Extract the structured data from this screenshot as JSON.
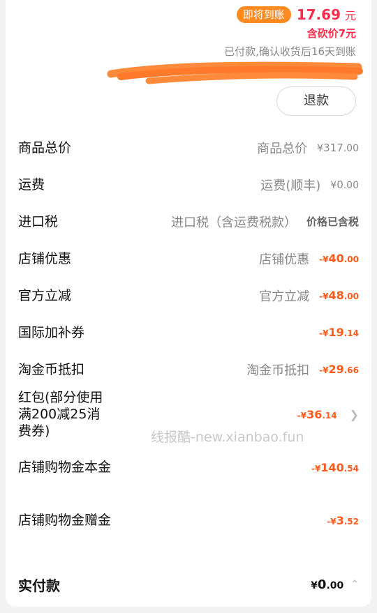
{
  "header": {
    "badge": "即将到账",
    "amount": "17.69",
    "amount_unit": "元",
    "cut_price": "含砍价7元",
    "note": "已付款,确认收货后16天到账",
    "refund_button": "退款"
  },
  "rows": [
    {
      "label": "商品总价",
      "desc": "商品总价",
      "currency": "¥",
      "amount_int": "317",
      "amount_dec": ".00",
      "style": "grey"
    },
    {
      "label": "运费",
      "desc": "运费(顺丰)",
      "currency": "¥",
      "amount_int": "0",
      "amount_dec": ".00",
      "style": "grey"
    },
    {
      "label": "进口税",
      "desc": "进口税（含运费税款）",
      "note": "价格已含税"
    },
    {
      "label": "店铺优惠",
      "desc": "店铺优惠",
      "currency": "-¥",
      "amount_int": "40",
      "amount_dec": ".00",
      "style": "red"
    },
    {
      "label": "官方立减",
      "desc": "官方立减",
      "currency": "-¥",
      "amount_int": "48",
      "amount_dec": ".00",
      "style": "red"
    },
    {
      "label": "国际加补券",
      "currency": "-¥",
      "amount_int": "19",
      "amount_dec": ".14",
      "style": "red"
    },
    {
      "label": "淘金币抵扣",
      "desc": "淘金币抵扣",
      "currency": "-¥",
      "amount_int": "29",
      "amount_dec": ".66",
      "style": "red"
    },
    {
      "label": "红包(部分使用满200减25消费券)",
      "currency": "-¥",
      "amount_int": "36",
      "amount_dec": ".14",
      "style": "red"
    },
    {
      "label": "店铺购物金本金",
      "currency": "-¥",
      "amount_int": "140",
      "amount_dec": ".54",
      "style": "red"
    },
    {
      "label": "店铺购物金赠金",
      "currency": "-¥",
      "amount_int": "3",
      "amount_dec": ".52",
      "style": "red"
    }
  ],
  "watermark": "线报酷-new.xianbao.fun",
  "total": {
    "label": "实付款",
    "currency": "¥",
    "amount_int": "0",
    "amount_dec": ".00"
  },
  "colors": {
    "accent_red": "#ff2d4b",
    "discount_orange": "#ff5a1a",
    "badge_orange": "#ff8a1f"
  },
  "icons": [
    "chevron-right-icon",
    "chevron-up-icon",
    "redaction-scribble"
  ]
}
